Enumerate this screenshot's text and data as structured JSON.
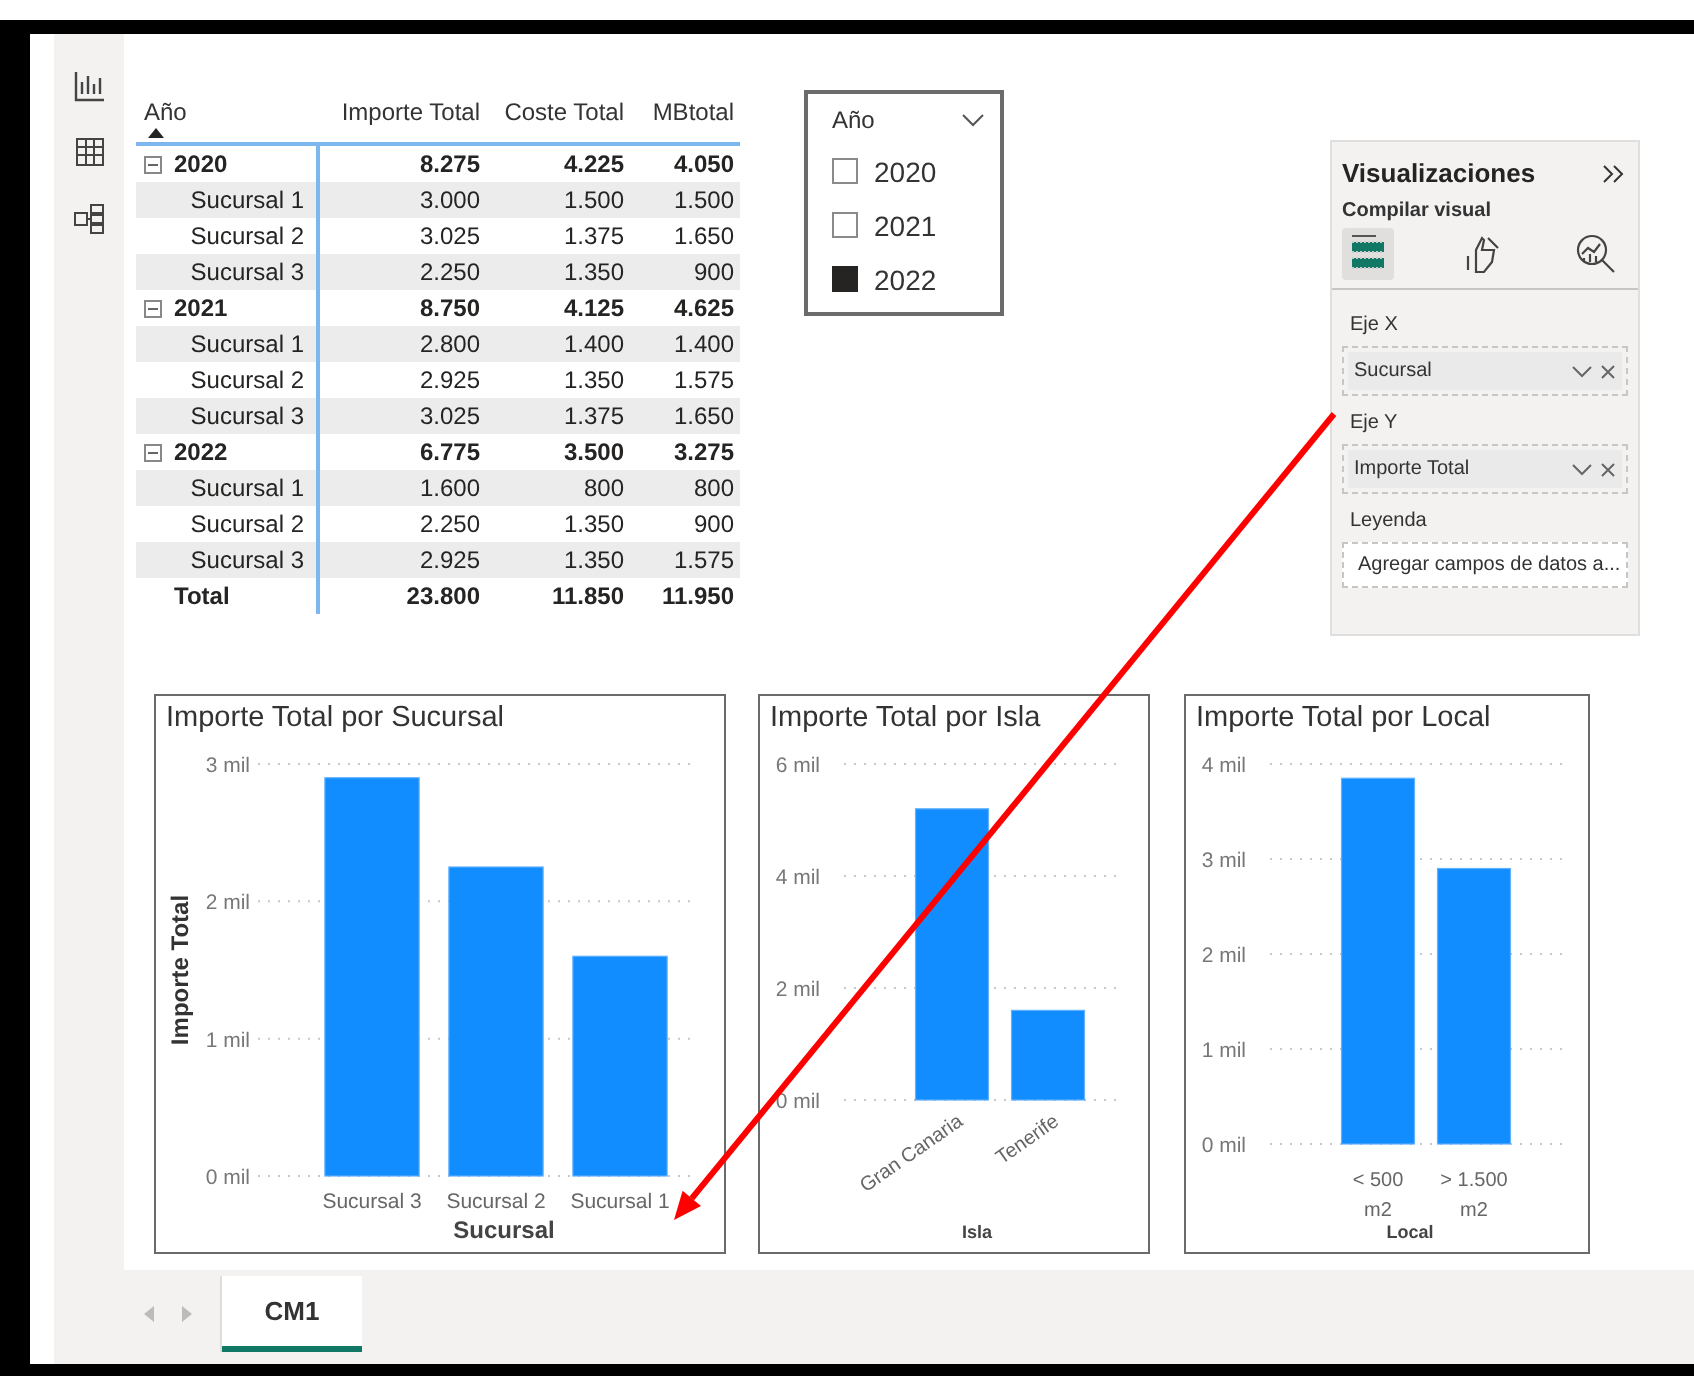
{
  "matrix": {
    "columns": [
      {
        "label": "Año",
        "sorted": true
      },
      {
        "label": "Importe Total",
        "sorted": false
      },
      {
        "label": "Coste Total",
        "sorted": false
      },
      {
        "label": "MBtotal",
        "sorted": false
      }
    ],
    "groups": [
      {
        "label": "2020",
        "expanded": true,
        "values": [
          "8.275",
          "4.225",
          "4.050"
        ],
        "children": [
          {
            "label": "Sucursal 1",
            "values": [
              "3.000",
              "1.500",
              "1.500"
            ]
          },
          {
            "label": "Sucursal 2",
            "values": [
              "3.025",
              "1.375",
              "1.650"
            ]
          },
          {
            "label": "Sucursal 3",
            "values": [
              "2.250",
              "1.350",
              "900"
            ]
          }
        ]
      },
      {
        "label": "2021",
        "expanded": true,
        "values": [
          "8.750",
          "4.125",
          "4.625"
        ],
        "children": [
          {
            "label": "Sucursal 1",
            "values": [
              "2.800",
              "1.400",
              "1.400"
            ]
          },
          {
            "label": "Sucursal 2",
            "values": [
              "2.925",
              "1.350",
              "1.575"
            ]
          },
          {
            "label": "Sucursal 3",
            "values": [
              "3.025",
              "1.375",
              "1.650"
            ]
          }
        ]
      },
      {
        "label": "2022",
        "expanded": true,
        "values": [
          "6.775",
          "3.500",
          "3.275"
        ],
        "children": [
          {
            "label": "Sucursal 1",
            "values": [
              "1.600",
              "800",
              "800"
            ]
          },
          {
            "label": "Sucursal 2",
            "values": [
              "2.250",
              "1.350",
              "900"
            ]
          },
          {
            "label": "Sucursal 3",
            "values": [
              "2.925",
              "1.350",
              "1.575"
            ]
          }
        ]
      }
    ],
    "total": {
      "label": "Total",
      "values": [
        "23.800",
        "11.850",
        "11.950"
      ]
    }
  },
  "slicer": {
    "title": "Año",
    "items": [
      {
        "label": "2020",
        "selected": false
      },
      {
        "label": "2021",
        "selected": false
      },
      {
        "label": "2022",
        "selected": true
      }
    ]
  },
  "visualizations": {
    "title": "Visualizaciones",
    "subtitle": "Compilar visual",
    "tabs": [
      {
        "kind": "build",
        "selected": true
      },
      {
        "kind": "format",
        "selected": false
      },
      {
        "kind": "analytics",
        "selected": false
      }
    ],
    "wells": [
      {
        "label": "Eje X",
        "field": "Sucursal"
      },
      {
        "label": "Eje Y",
        "field": "Importe Total"
      },
      {
        "label": "Leyenda",
        "placeholder": "Agregar campos de datos a..."
      }
    ]
  },
  "charts": [
    {
      "title": "Importe Total por Sucursal",
      "chart_data": {
        "type": "bar",
        "grid": true,
        "xlabel": "Sucursal",
        "ylabel": "Importe Total",
        "categories": [
          "Sucursal 3",
          "Sucursal 2",
          "Sucursal 1"
        ],
        "series": [
          {
            "color": "#118dff",
            "values": [
              2.9,
              2.25,
              1.6
            ]
          }
        ],
        "ylim": [
          0,
          3
        ],
        "yticks": [
          {
            "value": 0,
            "label": "0 mil"
          },
          {
            "value": 1,
            "label": "1 mil"
          },
          {
            "value": 2,
            "label": "2 mil"
          },
          {
            "value": 3,
            "label": "3 mil"
          }
        ]
      }
    },
    {
      "title": "Importe Total por Isla",
      "chart_data": {
        "type": "bar",
        "grid": true,
        "xlabel": "Isla",
        "categories": [
          "Gran Canaria",
          "Tenerife"
        ],
        "series": [
          {
            "color": "#118dff",
            "values": [
              5.2,
              1.6
            ]
          }
        ],
        "ylim": [
          0,
          6
        ],
        "yticks": [
          {
            "value": 0,
            "label": "0 mil"
          },
          {
            "value": 2,
            "label": "2 mil"
          },
          {
            "value": 4,
            "label": "4 mil"
          },
          {
            "value": 6,
            "label": "6 mil"
          }
        ]
      }
    },
    {
      "title": "Importe Total por Local",
      "chart_data": {
        "type": "bar",
        "grid": true,
        "xlabel": "Local",
        "categories": [
          "< 500 m2",
          "> 1.500 m2"
        ],
        "series": [
          {
            "color": "#118dff",
            "values": [
              3.85,
              2.9
            ]
          }
        ],
        "ylim": [
          0,
          4
        ],
        "yticks": [
          {
            "value": 0,
            "label": "0 mil"
          },
          {
            "value": 1,
            "label": "1 mil"
          },
          {
            "value": 2,
            "label": "2 mil"
          },
          {
            "value": 3,
            "label": "3 mil"
          },
          {
            "value": 4,
            "label": "4 mil"
          }
        ]
      }
    }
  ],
  "page_tabs": [
    {
      "label": "CM1",
      "selected": true
    }
  ]
}
